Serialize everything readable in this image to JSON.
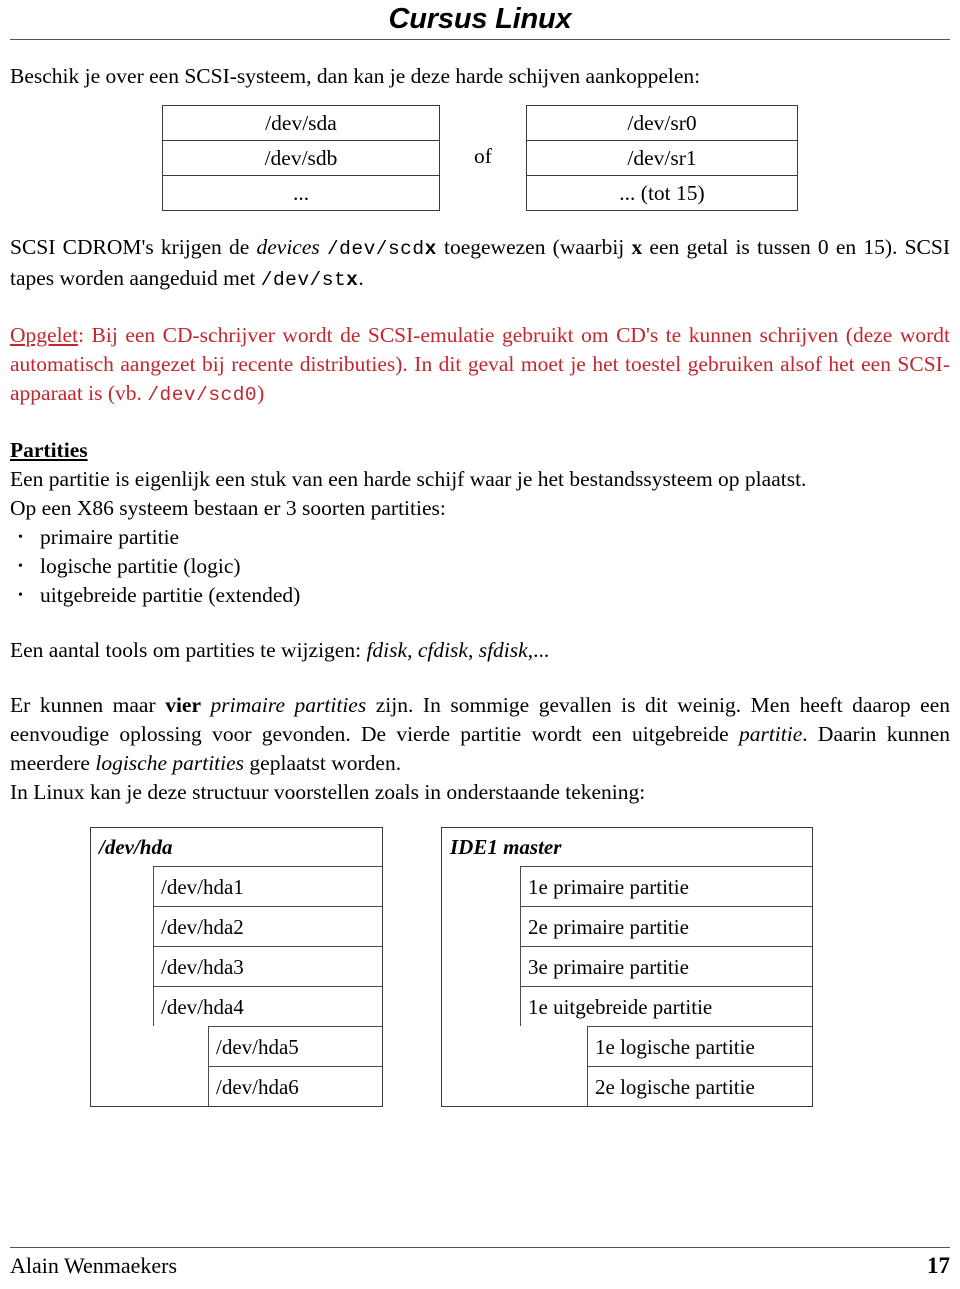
{
  "header": {
    "title": "Cursus Linux"
  },
  "intro": {
    "line": "Beschik je over een SCSI-systeem, dan kan je deze harde schijven aankoppelen:"
  },
  "device_tables": {
    "left": {
      "rows": [
        "/dev/sda",
        "/dev/sdb",
        "..."
      ]
    },
    "conjunction": "of",
    "right": {
      "rows": [
        "/dev/sr0",
        "/dev/sr1",
        "... (tot 15)"
      ]
    }
  },
  "scsi_paragraph": {
    "part1": "SCSI CDROM's krijgen de ",
    "italic1": "devices",
    "space1": " ",
    "code1_prefix": "/dev/scd",
    "code1_bold": "x",
    "part2": " toegewezen (waarbij ",
    "bold1": "x",
    "part3": " een getal is tussen 0 en 15). SCSI tapes worden aangeduid met ",
    "code2_prefix": "/dev/st",
    "code2_bold": "x",
    "part4": "."
  },
  "opgelet_note": {
    "label": "Opgelet",
    "part1": ": Bij een CD-schrijver wordt de SCSI-emulatie gebruikt om CD's te kunnen schrijven (deze wordt automatisch aangezet bij recente distributies). In dit geval moet je het toestel gebruiken alsof het een SCSI-apparaat is (vb. ",
    "code": "/dev/scd0",
    "part2": ")"
  },
  "partities": {
    "heading": "Partities",
    "intro1": "Een partitie is eigenlijk een stuk van een harde schijf waar je het bestandssysteem op plaatst.",
    "intro2": "Op een X86 systeem bestaan er 3 soorten partities:",
    "bullet_char": "•",
    "bullets": [
      "primaire partitie",
      "logische partitie (logic)",
      "uitgebreide partitie (extended)"
    ],
    "tools": {
      "prefix": "Een aantal tools om partities te wijzigen: ",
      "items": [
        "fdisk",
        "cfdisk",
        "sfdisk"
      ],
      "separator": ", ",
      "suffix": ",..."
    },
    "explanation": {
      "part1": "Er kunnen maar ",
      "bold1": "vier",
      "part2": " ",
      "italic1": "primaire partities",
      "part3": " zijn. In sommige gevallen is dit weinig. Men heeft daarop een eenvoudige oplossing voor gevonden. De vierde partitie wordt een uitgebreide ",
      "italic2": "partitie",
      "part4": ". Daarin kunnen meerdere ",
      "italic3": "logische partities",
      "part5": " geplaatst worden."
    },
    "drawing_intro": "In Linux kan je deze structuur voorstellen zoals in onderstaande tekening:"
  },
  "diagram": {
    "left": {
      "title": "/dev/hda",
      "level1": [
        "/dev/hda1",
        "/dev/hda2",
        "/dev/hda3",
        "/dev/hda4"
      ],
      "level2": [
        "/dev/hda5",
        "/dev/hda6"
      ]
    },
    "right": {
      "title": "IDE1 master",
      "level1": [
        "1e primaire partitie",
        "2e primaire partitie",
        "3e primaire partitie",
        "1e uitgebreide partitie"
      ],
      "level2": [
        "1e logische partitie",
        "2e logische partitie"
      ]
    }
  },
  "footer": {
    "author": "Alain Wenmaekers",
    "page_number": "17"
  },
  "colors": {
    "note_red": "#C2272D",
    "rule_gray": "#555555",
    "border_gray": "#3a3a3a"
  }
}
